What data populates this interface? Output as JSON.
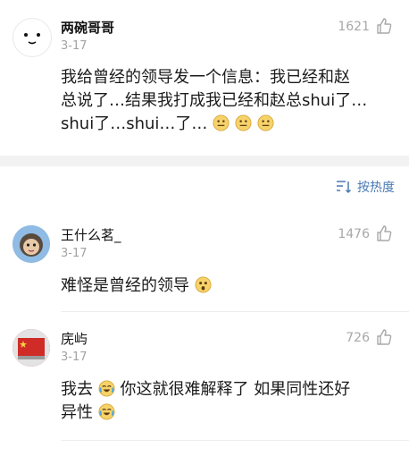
{
  "comments": [
    {
      "username": "两碗哥哥",
      "date": "3-17",
      "likes": "1621",
      "text_line1": "我给曾经的领导发一个信息：我已经和赵",
      "text_line2": "总说了…结果我打成我已经和赵总shui了…",
      "text_line3": "shui了…shui…了…"
    },
    {
      "username": "王什么茗_",
      "date": "3-17",
      "likes": "1476",
      "text": "难怪是曾经的领导"
    },
    {
      "username": "庑屿",
      "date": "3-17",
      "likes": "726",
      "text_part1": "我去",
      "text_part2": "你这就很难解释了 如果同性还好",
      "text_line2": "异性"
    }
  ],
  "sort": {
    "label": "按热度",
    "icon": "sort-icon"
  },
  "colors": {
    "link_blue": "#4a79b3",
    "meta_gray": "#a3a3a3",
    "band_gray": "#f2f2f2"
  }
}
